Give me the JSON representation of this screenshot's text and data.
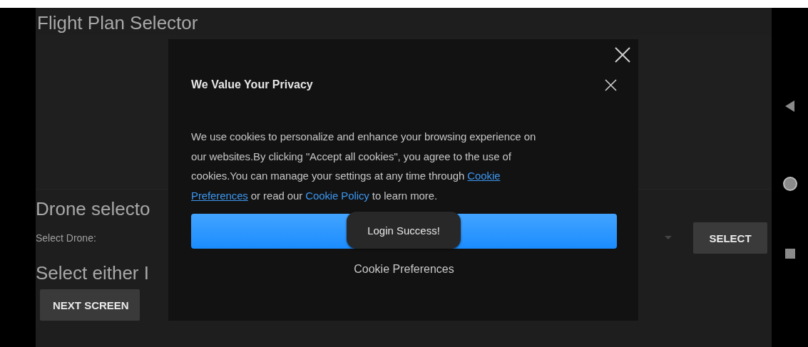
{
  "app": {
    "title": "Flight Plan Selector",
    "drone_section": {
      "heading": "Drone selecto",
      "label": "Select Drone:",
      "select_button": "SELECT"
    },
    "mode_section": {
      "heading": "Select either I",
      "next_button": "NEXT SCREEN"
    }
  },
  "privacy_dialog": {
    "title": "We Value Your Privacy",
    "body": [
      [
        {
          "kind": "text",
          "text": "We use cookies to personalize and enhance your browsing experience on"
        }
      ],
      [
        {
          "kind": "text",
          "text": "our websites.By clicking \"Accept all cookies\", you agree to the use of"
        }
      ],
      [
        {
          "kind": "text",
          "text": "cookies.You can manage your settings at any time through "
        },
        {
          "kind": "link",
          "text": "Cookie",
          "underlined": true
        }
      ],
      [
        {
          "kind": "link",
          "text": "Preferences",
          "underlined": true
        },
        {
          "kind": "text",
          "text": " or read our "
        },
        {
          "kind": "link",
          "text": "Cookie Policy",
          "underlined": false
        },
        {
          "kind": "text",
          "text": " to learn more."
        }
      ]
    ],
    "secondary_button": "Cookie Preferences"
  },
  "toast": {
    "message": "Login Success!"
  }
}
